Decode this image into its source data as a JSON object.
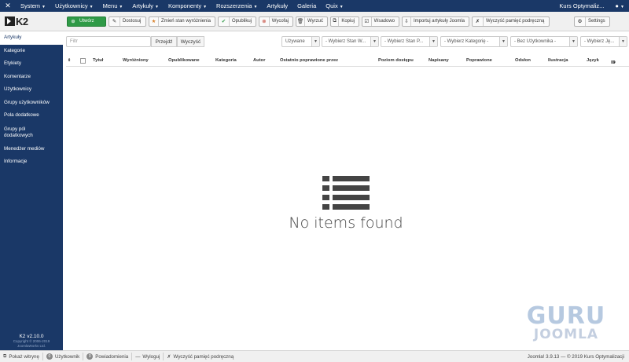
{
  "topbar": {
    "menu": [
      "System",
      "Użytkownicy",
      "Menu",
      "Artykuły",
      "Komponenty",
      "Rozszerzenia",
      "Artykuły",
      "Galeria",
      "Quix"
    ],
    "site_name": "Kurs Optymaliz...",
    "user_icon": "user-icon"
  },
  "toolbar": {
    "buttons": [
      {
        "label": "Utwórz",
        "icon": "plus-circle-icon"
      },
      {
        "label": "Dostosuj",
        "icon": "edit-icon"
      },
      {
        "label": "Zmień stan wyróżnienia",
        "icon": "star-icon"
      },
      {
        "label": "Opublikuj",
        "icon": "check-icon"
      },
      {
        "label": "Wycofaj",
        "icon": "unpublish-icon"
      },
      {
        "label": "Wyrzuć",
        "icon": "trash-icon"
      },
      {
        "label": "Kopiuj",
        "icon": "copy-icon"
      },
      {
        "label": "Wsadowo",
        "icon": "batch-icon"
      },
      {
        "label": "Importuj artykuły Joomla",
        "icon": "import-icon"
      },
      {
        "label": "Wyczyść pamięć podręczną",
        "icon": "broom-icon"
      },
      {
        "label": "Settings",
        "icon": "gear-icon"
      }
    ]
  },
  "sidebar": {
    "items": [
      "Artykuły",
      "Kategorie",
      "Etykiety",
      "Komentarze",
      "Użytkownicy",
      "Grupy użytkowników",
      "Pola dodatkowe",
      "Grupy pól dodatkowych",
      "Menedżer mediów",
      "Informacje"
    ],
    "version": "K2 v2.10.0",
    "copyright": "Copyright © 2006-2019",
    "company": "JoomlaWorks Ltd."
  },
  "filters": {
    "search_placeholder": "Filtr",
    "go_label": "Przejdź",
    "clear_label": "Wyczyść",
    "selects": [
      "Używane",
      "- Wybierz Stan W...",
      "- Wybierz Stan P...",
      "- Wybierz Kategorię -",
      "- Bez Użytkownika -",
      "- Wybierz Ję..."
    ]
  },
  "table": {
    "columns": [
      "Tytuł",
      "Wyróżniony",
      "Opublikowane",
      "Kategoria",
      "Autor",
      "Ostatnio poprawione przez",
      "Poziom dostępu",
      "Napisany",
      "Poprawione",
      "Odsłon",
      "Ilustracja",
      "Język",
      "ID"
    ],
    "sort_indicator": "▼"
  },
  "empty": {
    "message": "No items found",
    "icon": "list-icon"
  },
  "watermark": {
    "line1": "GURU",
    "line2": "JOOMLA"
  },
  "statusbar": {
    "view_site": "Pokaż witrynę",
    "users_count": "0",
    "users_label": "Użytkownik",
    "messages_count": "0",
    "messages_label": "Powiadomienia",
    "logout": "Wyloguj",
    "clear_cache": "Wyczyść pamięć podręczną",
    "footer": "Joomla! 3.9.13 — © 2019 Kurs Optymalizacji"
  },
  "colors": {
    "brand": "#1a3867",
    "create_button": "#2f9a47"
  }
}
